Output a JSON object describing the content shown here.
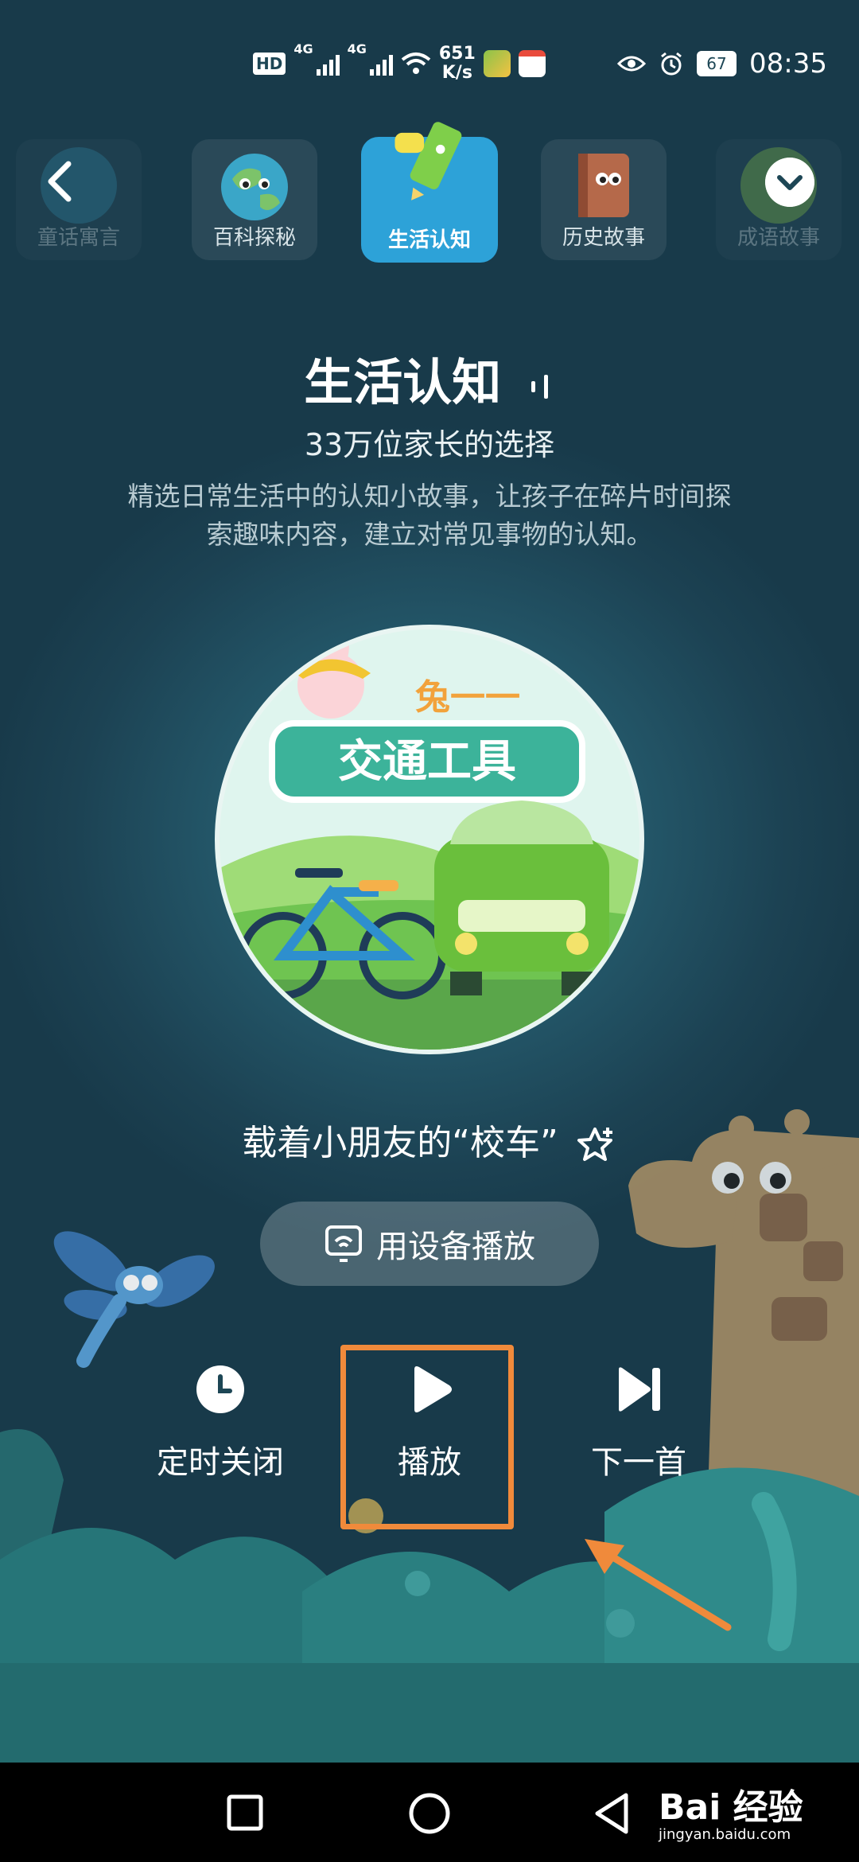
{
  "status_bar": {
    "hd_badge": "HD",
    "net_label_1": "4G",
    "net_label_2": "4G",
    "net_speed_value": "651",
    "net_speed_unit": "K/s",
    "battery": "67",
    "time": "08:35",
    "icons": [
      "eye-icon",
      "alarm-icon",
      "wifi-icon",
      "signal-icon"
    ]
  },
  "categories": [
    {
      "label": "童话寓言",
      "state": "faded"
    },
    {
      "label": "百科探秘",
      "state": "normal"
    },
    {
      "label": "生活认知",
      "state": "active"
    },
    {
      "label": "历史故事",
      "state": "normal"
    },
    {
      "label": "成语故事",
      "state": "faded"
    }
  ],
  "header": {
    "title": "生活认知",
    "subtitle": "33万位家长的选择",
    "description": "精选日常生活中的认知小故事，让孩子在碎片时间探索趣味内容，建立对常见事物的认知。"
  },
  "cover": {
    "brand": "兔一一",
    "caption": "交通工具"
  },
  "track": {
    "title": "载着小朋友的“校车”"
  },
  "device_play": {
    "label": "用设备播放"
  },
  "controls": {
    "timer_label": "定时关闭",
    "play_label": "播放",
    "next_label": "下一首"
  },
  "colors": {
    "accent_blue": "#2da2d8",
    "highlight_orange": "#f08a3b",
    "background": "#1d4655"
  },
  "watermark": {
    "text": "Bai 经验",
    "sub": "jingyan.baidu.com"
  }
}
